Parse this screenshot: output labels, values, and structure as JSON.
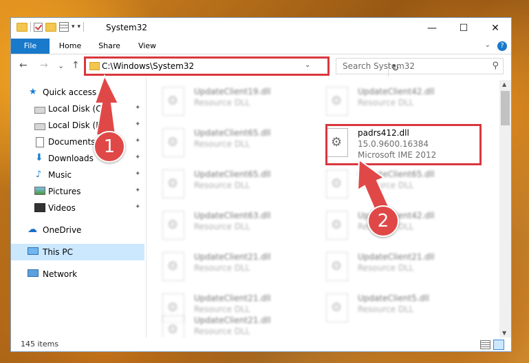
{
  "window": {
    "title": "System32",
    "quick_access_dropdown": "▾"
  },
  "window_controls": {
    "minimize": "—",
    "maximize": "☐",
    "close": "✕"
  },
  "ribbon": {
    "tabs": [
      {
        "label": "File",
        "active": true
      },
      {
        "label": "Home"
      },
      {
        "label": "Share"
      },
      {
        "label": "View"
      }
    ],
    "expand_chevron": "⌄",
    "help": "?"
  },
  "nav": {
    "back": "←",
    "forward": "→",
    "recent": "⌄",
    "up": "↑",
    "address": "C:\\Windows\\System32",
    "address_dropdown": "⌄",
    "refresh": "↻",
    "search_placeholder": "Search System32",
    "search_icon": "magnifier-icon"
  },
  "sidebar": {
    "items": [
      {
        "label": "Quick access",
        "icon": "star-icon",
        "glyph": "★"
      },
      {
        "label": "Local Disk (C:)",
        "icon": "disk-icon",
        "pinned": true
      },
      {
        "label": "Local Disk (D:)",
        "icon": "disk-icon",
        "pinned": true
      },
      {
        "label": "Documents",
        "icon": "document-icon",
        "pinned": true
      },
      {
        "label": "Downloads",
        "icon": "download-icon",
        "glyph": "⬇",
        "pinned": true
      },
      {
        "label": "Music",
        "icon": "music-icon",
        "glyph": "♪",
        "pinned": true
      },
      {
        "label": "Pictures",
        "icon": "pictures-icon",
        "pinned": true
      },
      {
        "label": "Videos",
        "icon": "video-icon",
        "pinned": true
      },
      {
        "label": "OneDrive",
        "icon": "cloud-icon",
        "glyph": "☁"
      },
      {
        "label": "This PC",
        "icon": "computer-icon",
        "selected": true
      },
      {
        "label": "Network",
        "icon": "network-icon"
      }
    ],
    "pin_glyph": "📌"
  },
  "files": {
    "left_column": [
      {
        "name": "UpdateClient19.dll",
        "type": "Resource DLL"
      },
      {
        "name": "UpdateClient65.dll",
        "type": "Resource DLL"
      },
      {
        "name": "UpdateClient65.dll",
        "type": "Resource DLL"
      },
      {
        "name": "UpdateClient63.dll",
        "type": "Resource DLL"
      },
      {
        "name": "UpdateClient21.dll",
        "type": "Resource DLL"
      },
      {
        "name": "UpdateClient21.dll",
        "type": "Resource DLL"
      },
      {
        "name": "UpdateClient21.dll",
        "type": "Resource DLL"
      }
    ],
    "right_column": [
      {
        "name": "UpdateClient42.dll",
        "type": "Resource DLL"
      },
      {
        "name": "padrs412.dll",
        "version": "15.0.9600.16384",
        "company": "Microsoft IME 2012",
        "highlighted": true
      },
      {
        "name": "UpdateClient65.dll",
        "type": "Resource DLL"
      },
      {
        "name": "UpdateClient42.dll",
        "type": "Resource DLL"
      },
      {
        "name": "UpdateClient21.dll",
        "type": "Resource DLL"
      },
      {
        "name": "UpdateClient5.dll",
        "type": "Resource DLL"
      }
    ]
  },
  "status": {
    "item_count": "145 items"
  },
  "annotations": {
    "step1": "1",
    "step2": "2",
    "accent": "#e04848"
  }
}
